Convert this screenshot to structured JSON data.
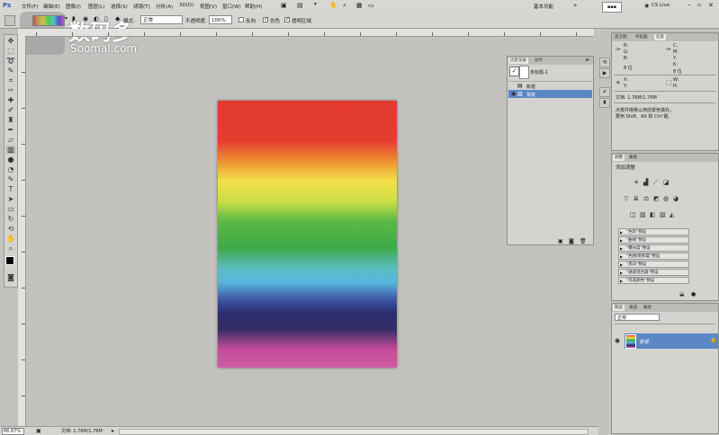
{
  "menu": {
    "items": [
      "文件(F)",
      "编辑(E)",
      "图像(I)",
      "图层(L)",
      "选择(S)",
      "滤镜(T)",
      "分析(A)",
      "3D(D)",
      "视图(V)",
      "窗口(W)",
      "帮助(H)"
    ],
    "workspace": "基本功能",
    "cslive": "CS Live"
  },
  "watermark": {
    "brand_cn": "数码多",
    "brand_en": "Soomal.com"
  },
  "options": {
    "mode_label": "模式:",
    "mode_value": "正常",
    "opacity_label": "不透明度:",
    "opacity_value": "100%",
    "reverse_label": "反向",
    "dither_label": "仿色",
    "transparency_label": "透明区域"
  },
  "history_panel": {
    "tabs": [
      "历史记录",
      "动作"
    ],
    "snapshot": "未标题-1",
    "items": [
      "新建",
      "渐变"
    ]
  },
  "info_panel": {
    "tabs": [
      "直方图",
      "导航器",
      "信息"
    ],
    "rows": [
      {
        "l": "R:",
        "r": "C:"
      },
      {
        "l": "G:",
        "r": "M:"
      },
      {
        "l": "B:",
        "r": "Y:"
      },
      {
        "l": "8 位",
        "r": "K:"
      },
      {
        "l": "",
        "r": "8 位"
      }
    ],
    "xy": {
      "x": "X:",
      "y": "Y:",
      "w": "W:",
      "h": "H:"
    },
    "doc": "文档: 1.76M/1.76M",
    "hint1": "点按并拖移以用前景色填充，",
    "hint2": "要用 Shift、Alt 和 Ctrl 键。"
  },
  "adjust_panel": {
    "tabs": [
      "调整",
      "蒙版"
    ],
    "title": "添加调整",
    "presets": [
      "\"色阶\"预设",
      "\"曲线\"预设",
      "\"曝光度\"预设",
      "\"色相/饱和度\"预设",
      "\"黑白\"预设",
      "\"通道混合器\"预设",
      "\"可选颜色\"预设"
    ]
  },
  "layers_panel": {
    "tabs": [
      "图层",
      "通道",
      "路径"
    ],
    "blend_mode": "正常",
    "layer_name": "背景"
  },
  "status": {
    "zoom": "66.67%",
    "doc": "文档: 1.76M/1.76M"
  }
}
